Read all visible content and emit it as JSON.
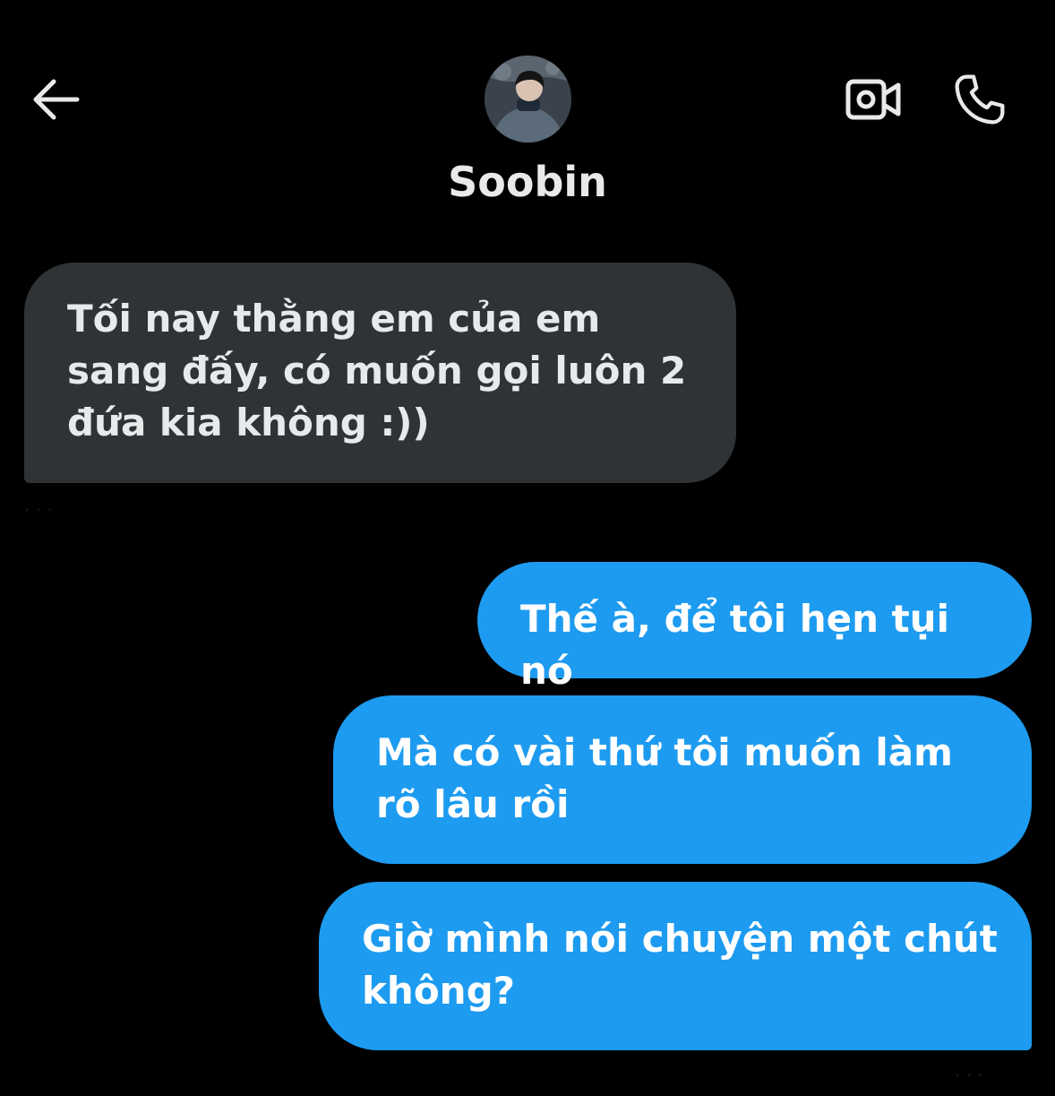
{
  "header": {
    "contact_name": "Soobin",
    "icons": {
      "back": "arrow-left-icon",
      "video_call": "video-camera-icon",
      "voice_call": "phone-icon"
    }
  },
  "messages": [
    {
      "direction": "incoming",
      "text": "Tối nay thằng em của em sang đấy, có muốn gọi luôn 2 đứa kia không :))"
    },
    {
      "direction": "outgoing",
      "text": "Thế à, để tôi hẹn tụi nó"
    },
    {
      "direction": "outgoing",
      "text": "Mà có vài thứ tôi muốn làm rõ lâu rồi"
    },
    {
      "direction": "outgoing",
      "text": "Giờ mình nói chuyện một chút không?"
    }
  ],
  "colors": {
    "background": "#000000",
    "incoming_bubble": "#2f3336",
    "outgoing_bubble": "#1d9bf0",
    "text_primary": "#e7e9ea"
  }
}
